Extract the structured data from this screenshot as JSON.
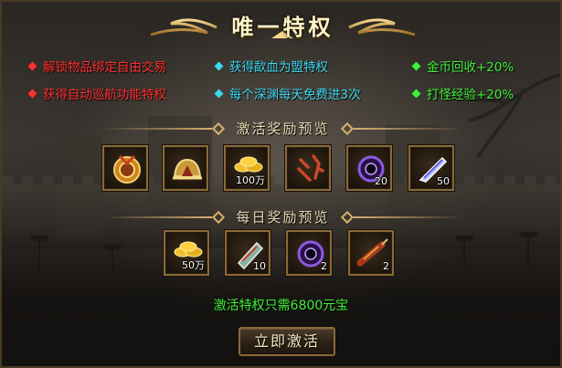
{
  "title": "唯一特权",
  "perks": [
    {
      "text": "解锁物品绑定自由交易",
      "color": "red"
    },
    {
      "text": "获得自动巡航功能特权",
      "color": "red"
    },
    {
      "text": "获得歃血为盟特权",
      "color": "cyan"
    },
    {
      "text": "每个深渊每天免费进3次",
      "color": "cyan"
    },
    {
      "text": "金币回收+20%",
      "color": "green"
    },
    {
      "text": "打怪经验+20%",
      "color": "green"
    }
  ],
  "activation_rewards": {
    "label": "激活奖励预览",
    "items": [
      {
        "icon": "gold-medal-icon",
        "count": ""
      },
      {
        "icon": "golden-helmet-icon",
        "count": ""
      },
      {
        "icon": "gold-ingots-icon",
        "count": "100万"
      },
      {
        "icon": "sword-glyph-icon",
        "count": ""
      },
      {
        "icon": "purple-orb-icon",
        "count": "20"
      },
      {
        "icon": "crystal-feather-icon",
        "count": "50"
      }
    ]
  },
  "daily_rewards": {
    "label": "每日奖励预览",
    "items": [
      {
        "icon": "gold-ingots-icon",
        "count": "50万"
      },
      {
        "icon": "scroll-icon",
        "count": "10"
      },
      {
        "icon": "purple-orb-icon",
        "count": "2"
      },
      {
        "icon": "firecracker-icon",
        "count": "2"
      }
    ]
  },
  "cost_text": "激活特权只需6800元宝",
  "activate_button": "立即激活",
  "colors": {
    "red": "#ff2f2f",
    "cyan": "#3fd8f0",
    "green": "#3ef03a",
    "gold": "#d8b070"
  }
}
